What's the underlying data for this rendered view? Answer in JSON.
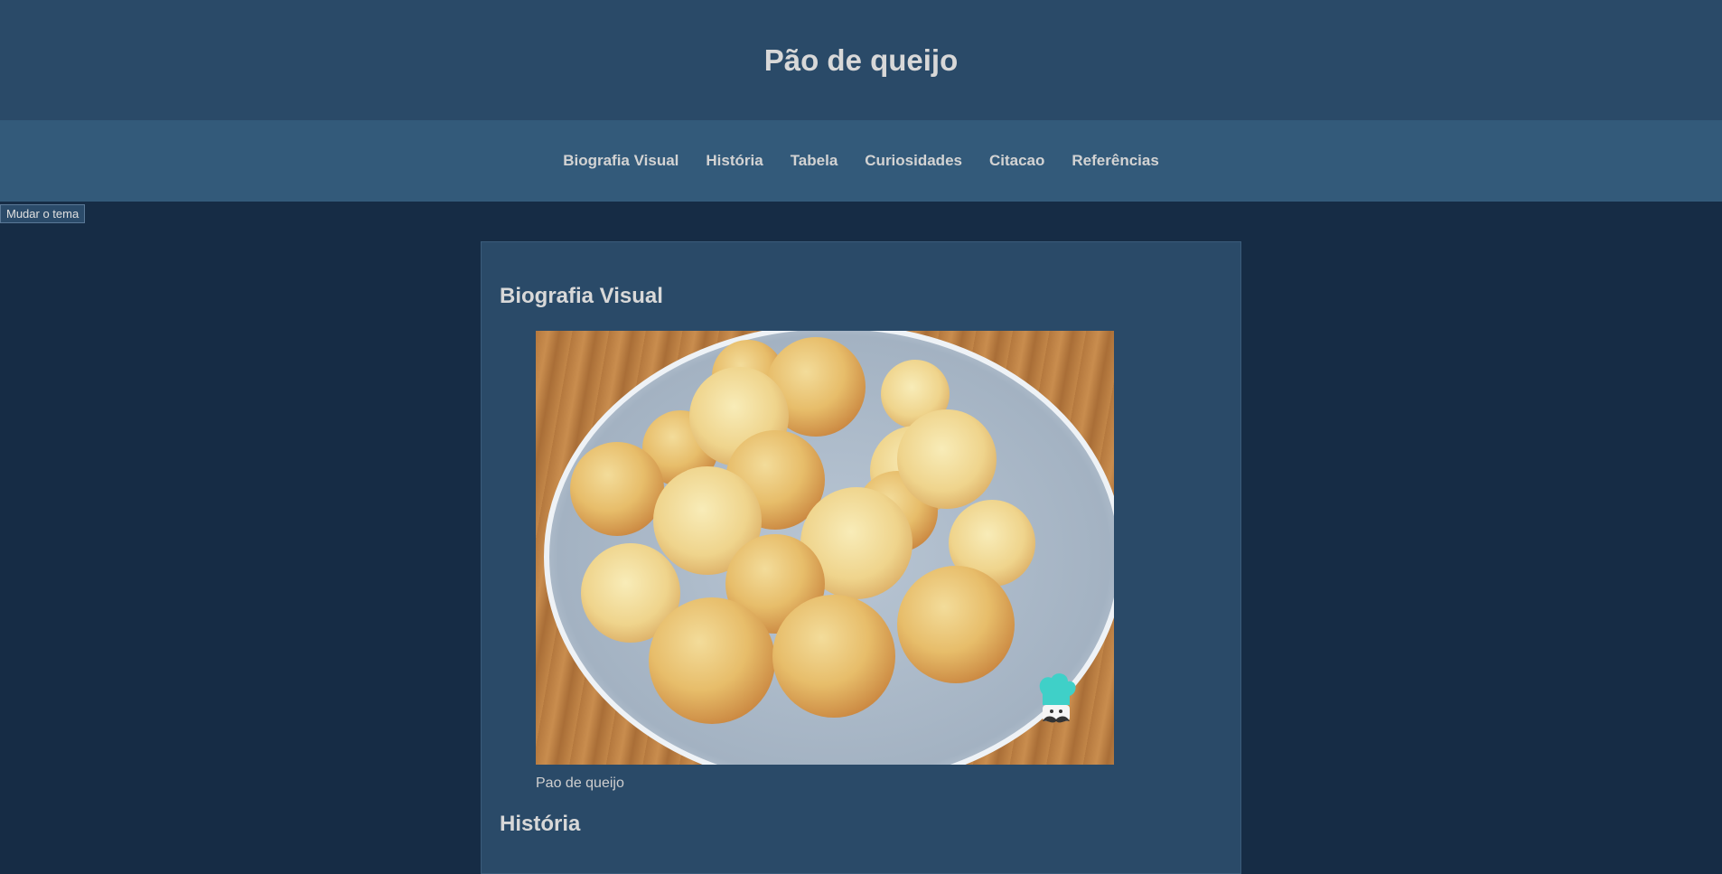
{
  "header": {
    "title": "Pão de queijo"
  },
  "nav": {
    "items": [
      {
        "label": "Biografia Visual"
      },
      {
        "label": "História"
      },
      {
        "label": "Tabela"
      },
      {
        "label": "Curiosidades"
      },
      {
        "label": "Citacao"
      },
      {
        "label": "Referências"
      }
    ]
  },
  "theme": {
    "button_label": "Mudar o tema"
  },
  "main": {
    "bio_title": "Biografia Visual",
    "photo_icon": "chef-hat-mustache-icon",
    "caption": "Pao de queijo",
    "history_title": "História"
  },
  "colors": {
    "header_bg": "#2a4a68",
    "nav_bg": "#335a7a",
    "page_bg": "#162c45",
    "card_bg": "#2a4a68"
  }
}
